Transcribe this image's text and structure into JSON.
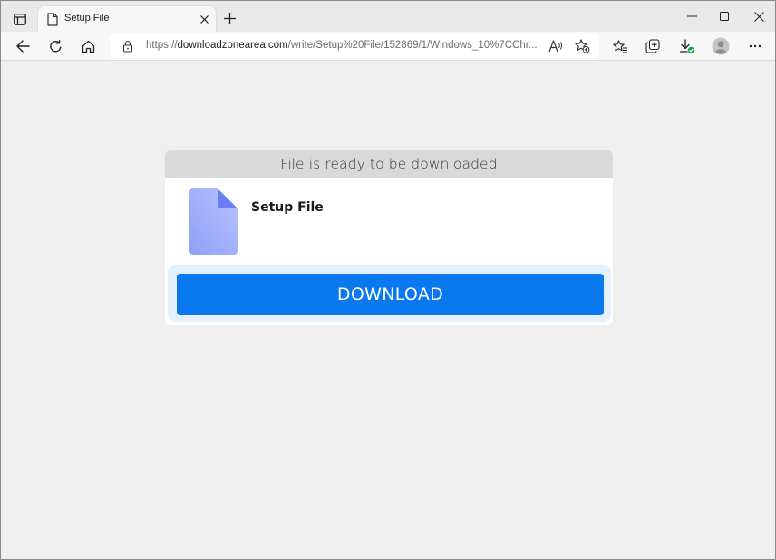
{
  "browser": {
    "tab": {
      "title": "Setup File"
    },
    "address_bar": {
      "url_scheme": "https://",
      "url_host": "downloadzonearea.com",
      "url_path": "/write/Setup%20File/152869/1/Windows_10%7CChr..."
    }
  },
  "page": {
    "card": {
      "header": "File is ready to be downloaded",
      "file_name": "Setup File",
      "download_label": "DOWNLOAD"
    }
  },
  "colors": {
    "download_button": "#0a78ef",
    "file_icon_light": "#b8c3ff",
    "file_icon_dark": "#6a7ef0",
    "download_ok_badge": "#1aa84a"
  },
  "icons": {
    "tab_actions": "tab-actions-icon",
    "favicon": "document-icon",
    "close": "close-icon",
    "new_tab": "plus-icon",
    "back": "back-arrow-icon",
    "refresh": "refresh-icon",
    "home": "home-icon",
    "lock": "lock-icon",
    "read_aloud": "read-aloud-icon",
    "add_favorite": "star-plus-icon",
    "favorites": "favorites-icon",
    "collections": "collections-icon",
    "downloads": "download-icon",
    "profile": "profile-avatar-icon",
    "more": "more-icon"
  }
}
